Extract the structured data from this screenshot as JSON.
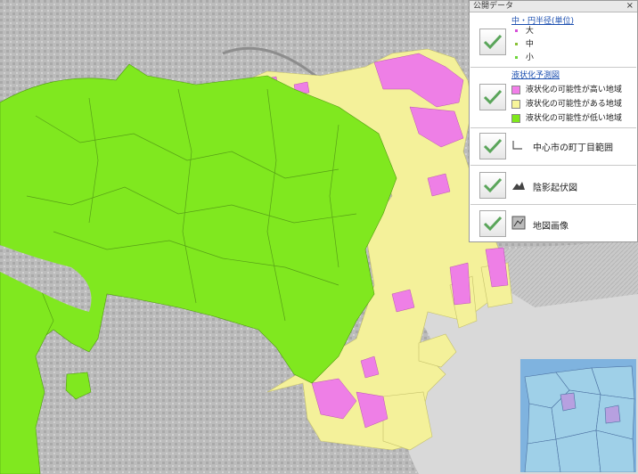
{
  "legend": {
    "title": "公開データ",
    "close_icon": "close-x",
    "panels": [
      {
        "title": "中・円半径(単位)",
        "items": [
          {
            "label": "大",
            "color": "#d64fd8"
          },
          {
            "label": "中",
            "color": "#88c034"
          },
          {
            "label": "小",
            "color": "#6ed63a"
          }
        ]
      },
      {
        "title": "液状化予測図",
        "items": [
          {
            "label": "液状化の可能性が高い地域",
            "color": "#f27ee9"
          },
          {
            "label": "液状化の可能性がある地域",
            "color": "#f7f59a"
          },
          {
            "label": "液状化の可能性が低い地域",
            "color": "#7fe81a"
          }
        ]
      },
      {
        "label": "中心市の町丁目範囲",
        "icon": "boundary-icon"
      },
      {
        "label": "陰影起伏図",
        "icon": "relief-icon"
      },
      {
        "label": "地図画像",
        "icon": "map-image-icon"
      }
    ]
  },
  "colors": {
    "high": "#f27ee9",
    "medium": "#f7f59a",
    "low": "#7fe81a",
    "sea": "#cfd0cf",
    "land": "#bdbdbd"
  }
}
